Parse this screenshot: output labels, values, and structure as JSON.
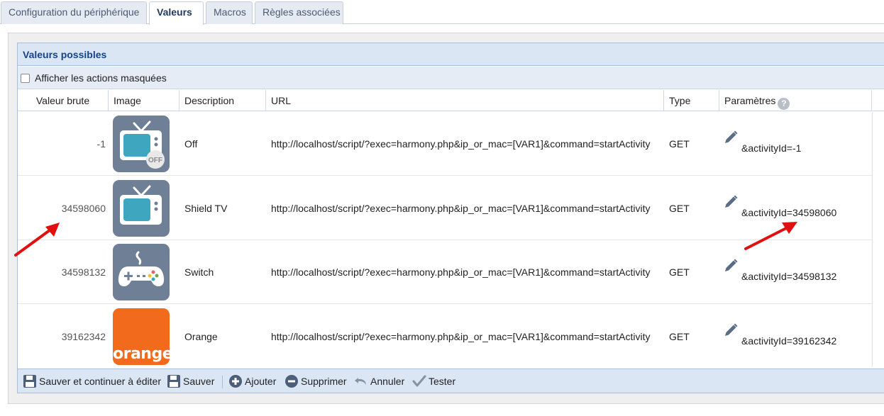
{
  "tabs": [
    {
      "label": "Configuration du périphérique",
      "active": false
    },
    {
      "label": "Valeurs",
      "active": true
    },
    {
      "label": "Macros",
      "active": false
    },
    {
      "label": "Règles associées",
      "active": false
    }
  ],
  "panel": {
    "title": "Valeurs possibles",
    "show_hidden_label": "Afficher les actions masquées",
    "show_hidden_checked": false
  },
  "table": {
    "columns": [
      "Valeur brute",
      "Image",
      "Description",
      "URL",
      "Type",
      "Paramètres"
    ],
    "rows": [
      {
        "raw": "-1",
        "icon": "tv-off-icon",
        "description": "Off",
        "url": "http://localhost/script/?exec=harmony.php&ip_or_mac=[VAR1]&command=startActivity",
        "type": "GET",
        "params": "&activityId=-1"
      },
      {
        "raw": "34598060",
        "icon": "tv-icon",
        "description": "Shield TV",
        "url": "http://localhost/script/?exec=harmony.php&ip_or_mac=[VAR1]&command=startActivity",
        "type": "GET",
        "params": "&activityId=34598060"
      },
      {
        "raw": "34598132",
        "icon": "gamepad-icon",
        "description": "Switch",
        "url": "http://localhost/script/?exec=harmony.php&ip_or_mac=[VAR1]&command=startActivity",
        "type": "GET",
        "params": "&activityId=34598132"
      },
      {
        "raw": "39162342",
        "icon": "orange-logo",
        "description": "Orange",
        "url": "http://localhost/script/?exec=harmony.php&ip_or_mac=[VAR1]&command=startActivity",
        "type": "GET",
        "params": "&activityId=39162342"
      }
    ]
  },
  "icons": {
    "off_badge": "OFF",
    "orange_logo_text": "orange",
    "tile_color": "#6e7f96",
    "orange_color": "#f26b1d",
    "screen_color": "#3fa6c0"
  },
  "toolbar": {
    "save_continue": "Sauver et continuer à éditer",
    "save": "Sauver",
    "add": "Ajouter",
    "delete": "Supprimer",
    "cancel": "Annuler",
    "test": "Tester"
  },
  "colors": {
    "header_bg": "#dbe6f4",
    "header_text": "#15428b",
    "annotation_arrow": "#e01010"
  }
}
